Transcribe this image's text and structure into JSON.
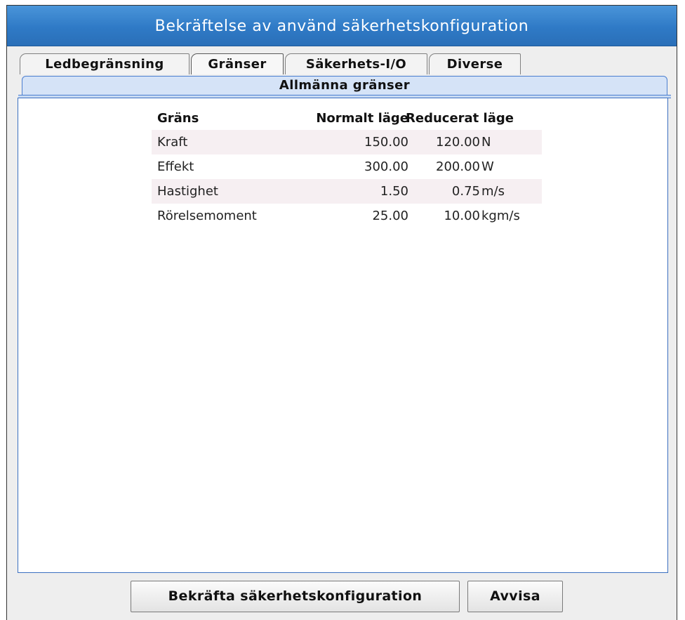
{
  "dialog": {
    "title": "Bekräftelse av använd säkerhetskonfiguration"
  },
  "tabs": [
    {
      "label": "Ledbegränsning",
      "active": false
    },
    {
      "label": "Gränser",
      "active": true
    },
    {
      "label": "Säkerhets-I/O",
      "active": false
    },
    {
      "label": "Diverse",
      "active": false
    }
  ],
  "subtab": {
    "label": "Allmänna gränser"
  },
  "table": {
    "headers": [
      "Gräns",
      "Normalt läge",
      "Reducerat läge"
    ],
    "rows": [
      {
        "name": "Kraft",
        "normal": "150.00",
        "reduced": "120.00",
        "unit": "N"
      },
      {
        "name": "Effekt",
        "normal": "300.00",
        "reduced": "200.00",
        "unit": "W"
      },
      {
        "name": "Hastighet",
        "normal": "1.50",
        "reduced": "0.75",
        "unit": "m/s"
      },
      {
        "name": "Rörelsemoment",
        "normal": "25.00",
        "reduced": "10.00",
        "unit": "kgm/s"
      }
    ]
  },
  "buttons": {
    "confirm_label": "Bekräfta säkerhetskonfiguration",
    "reject_label": "Avvisa"
  },
  "colors": {
    "titlebar": "#2f7ac6",
    "subtab": "#d5e3f7",
    "row_shade": "#f6eff2"
  }
}
